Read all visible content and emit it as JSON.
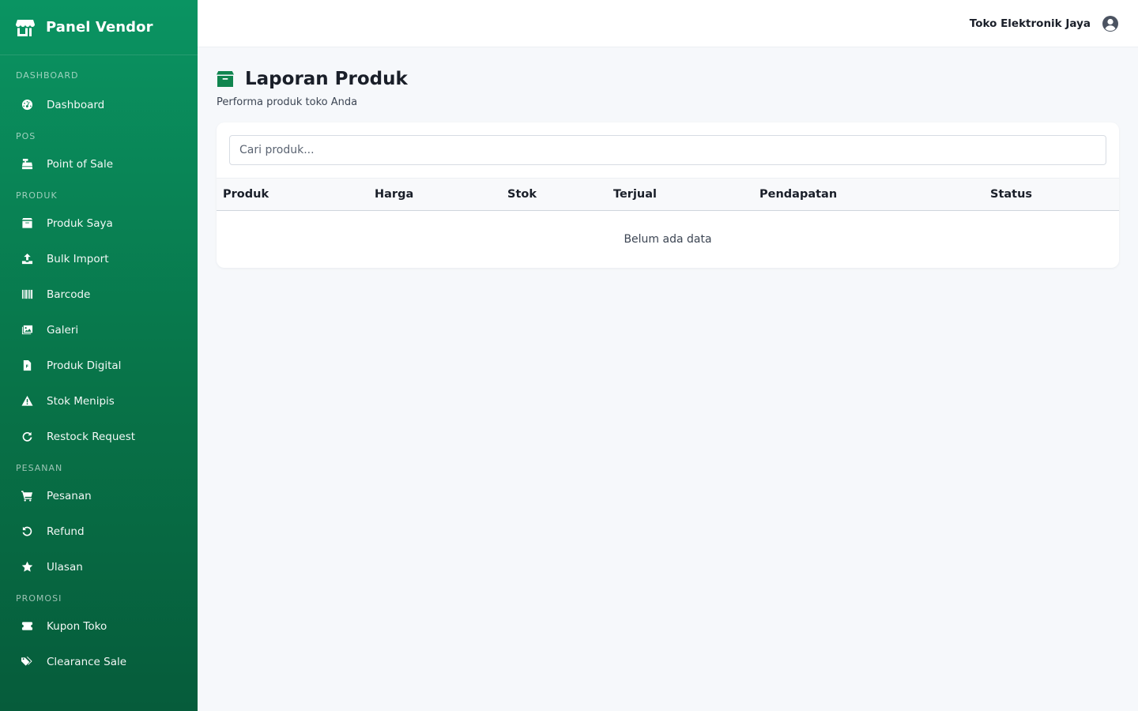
{
  "sidebar": {
    "brand": "Panel Vendor",
    "sections": {
      "dashboard": {
        "label": "DASHBOARD",
        "items": [
          {
            "label": "Dashboard",
            "icon": "gauge-icon"
          }
        ]
      },
      "pos": {
        "label": "POS",
        "items": [
          {
            "label": "Point of Sale",
            "icon": "cash-register-icon"
          }
        ]
      },
      "produk": {
        "label": "PRODUK",
        "items": [
          {
            "label": "Produk Saya",
            "icon": "box-icon"
          },
          {
            "label": "Bulk Import",
            "icon": "upload-icon"
          },
          {
            "label": "Barcode",
            "icon": "barcode-icon"
          },
          {
            "label": "Galeri",
            "icon": "images-icon"
          },
          {
            "label": "Produk Digital",
            "icon": "file-icon"
          },
          {
            "label": "Stok Menipis",
            "icon": "warning-icon"
          },
          {
            "label": "Restock Request",
            "icon": "refresh-icon"
          }
        ]
      },
      "pesanan": {
        "label": "PESANAN",
        "items": [
          {
            "label": "Pesanan",
            "icon": "cart-icon"
          },
          {
            "label": "Refund",
            "icon": "undo-icon"
          },
          {
            "label": "Ulasan",
            "icon": "star-icon"
          }
        ]
      },
      "promosi": {
        "label": "PROMOSI",
        "items": [
          {
            "label": "Kupon Toko",
            "icon": "ticket-icon"
          },
          {
            "label": "Clearance Sale",
            "icon": "tags-icon"
          }
        ]
      }
    }
  },
  "topbar": {
    "store_name": "Toko Elektronik Jaya",
    "account_icon": "user-circle-icon"
  },
  "page": {
    "title": "Laporan Produk",
    "title_icon": "box-icon",
    "subtitle": "Performa produk toko Anda",
    "search": {
      "placeholder": "Cari produk...",
      "value": ""
    },
    "table": {
      "columns": [
        "Produk",
        "Harga",
        "Stok",
        "Terjual",
        "Pendapatan",
        "Status"
      ],
      "rows": [],
      "empty_text": "Belum ada data"
    }
  },
  "colors": {
    "sidebar_top": "#0a9462",
    "sidebar_bottom": "#065c3b",
    "accent": "#0f8a57",
    "background": "#f6f8fb"
  }
}
